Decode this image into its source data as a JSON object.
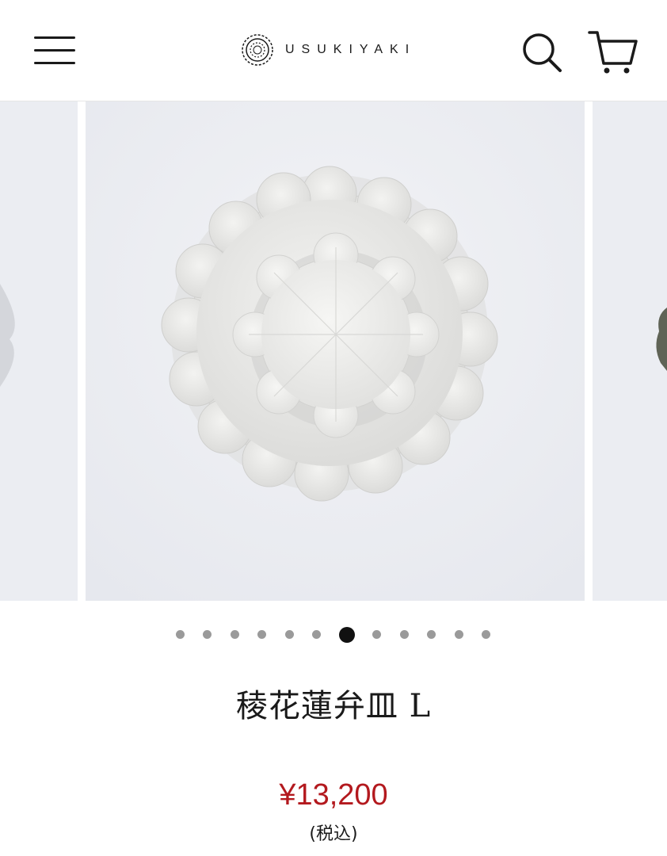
{
  "header": {
    "brand": "USUKIYAKI",
    "icons": {
      "menu": "menu-icon",
      "search": "search-icon",
      "cart": "cart-icon",
      "logo": "logo-mark-icon"
    }
  },
  "carousel": {
    "slide_count": 12,
    "active_index": 6,
    "zoom_icon": "zoom-icon"
  },
  "product": {
    "title": "稜花蓮弁皿 L",
    "price": "¥13,200",
    "tax_note": "(税込)"
  },
  "colors": {
    "price": "#b3191e",
    "dot_active": "#111111",
    "dot_inactive": "#9a9a9a",
    "photo_background": "#ebedf2"
  }
}
